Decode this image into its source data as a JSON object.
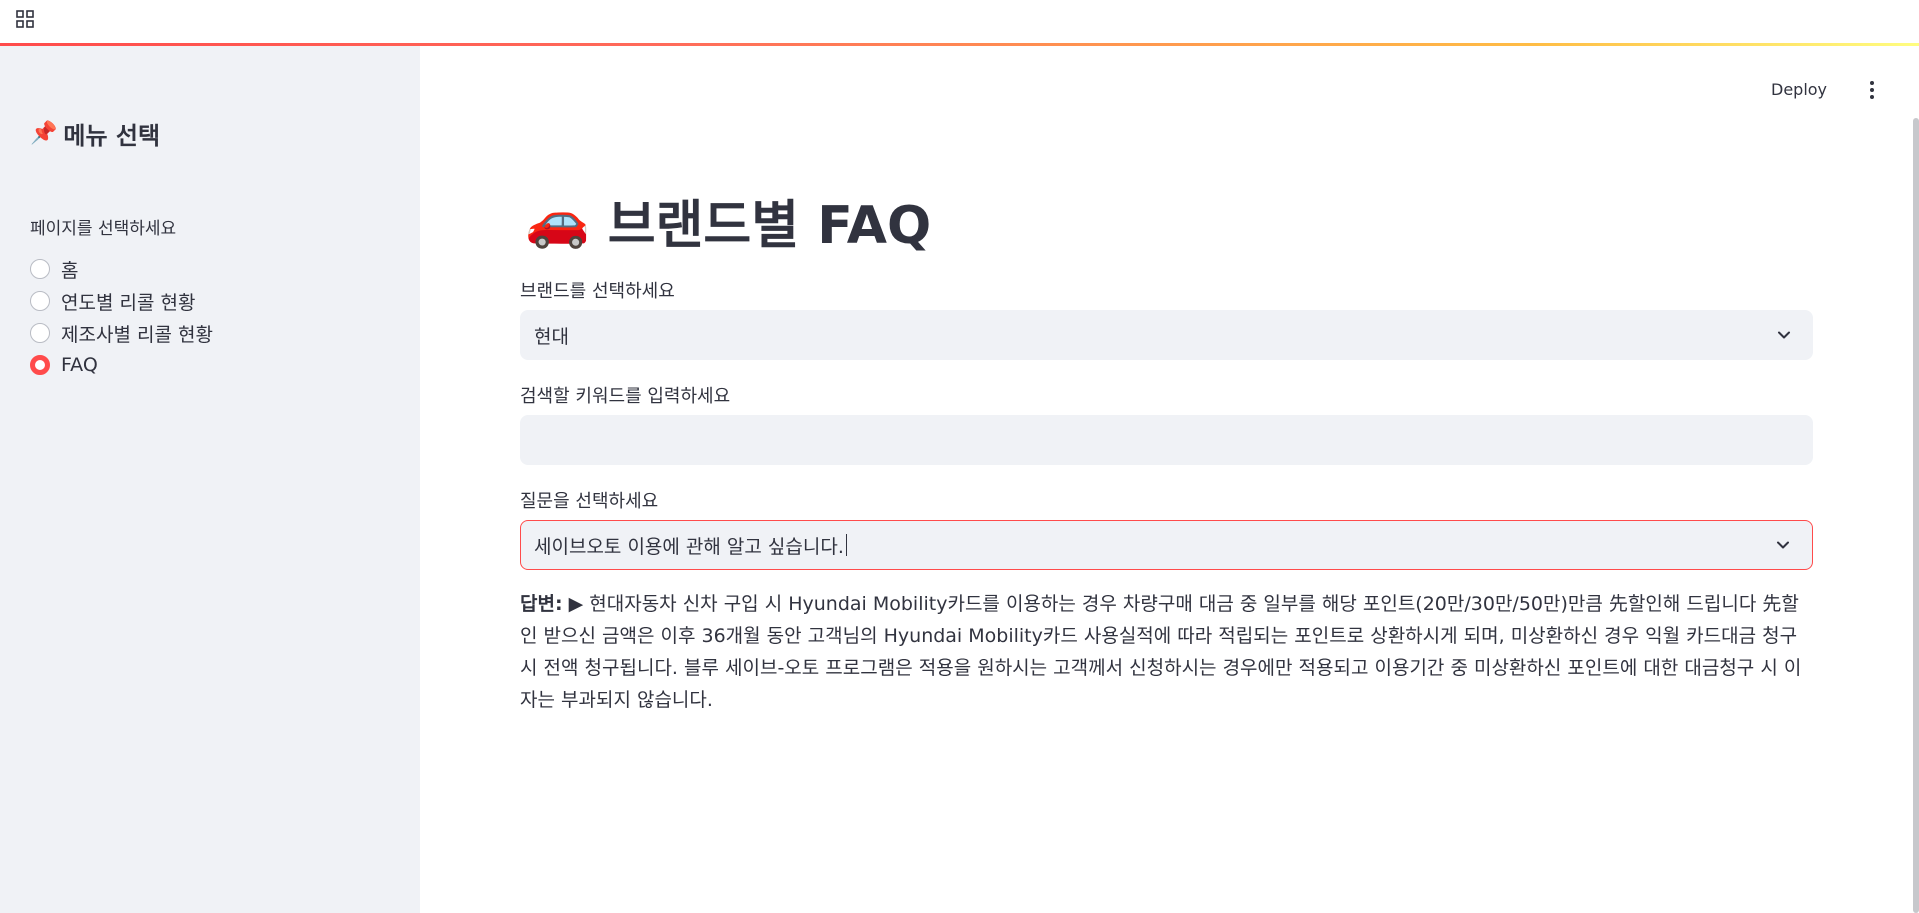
{
  "header": {
    "menu_icon": "grid-icon",
    "deploy_label": "Deploy",
    "more_icon": "kebab-menu-icon",
    "accent_gradient": [
      "#ff4b4b",
      "#ffbd45",
      "#fffd80"
    ]
  },
  "sidebar": {
    "title_icon": "📌",
    "title": "메뉴 선택",
    "radio_label": "페이지를 선택하세요",
    "options": [
      {
        "label": "홈",
        "selected": false
      },
      {
        "label": "연도별 리콜 현황",
        "selected": false
      },
      {
        "label": "제조사별 리콜 현황",
        "selected": false
      },
      {
        "label": "FAQ",
        "selected": true
      }
    ]
  },
  "main": {
    "title_icon": "🚗",
    "title": "브랜드별 FAQ",
    "brand_label": "브랜드를 선택하세요",
    "brand_value": "현대",
    "keyword_label": "검색할 키워드를 입력하세요",
    "keyword_value": "",
    "question_label": "질문을 선택하세요",
    "question_value": "세이브오토 이용에 관해 알고 싶습니다.",
    "answer_prefix": "답변:",
    "answer_text": "▶ 현대자동차 신차 구입 시 Hyundai Mobility카드를 이용하는 경우 차량구매 대금 중 일부를 해당 포인트(20만/30만/50만)만큼 先할인해 드립니다 先할인 받으신 금액은 이후 36개월 동안 고객님의 Hyundai Mobility카드 사용실적에 따라 적립되는 포인트로 상환하시게 되며, 미상환하신 경우 익월 카드대금 청구 시 전액 청구됩니다. 블루 세이브-오토 프로그램은 적용을 원하시는 고객께서 신청하시는 경우에만 적용되고 이용기간 중 미상환하신 포인트에 대한 대금청구 시 이자는 부과되지 않습니다.",
    "accent_color": "#ff4b4b"
  }
}
